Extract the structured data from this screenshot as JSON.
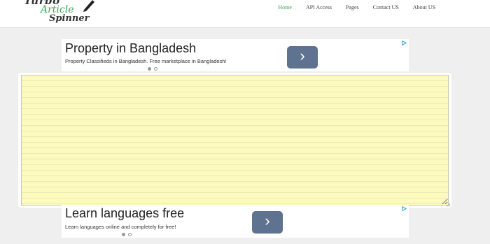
{
  "logo": {
    "line1": "Turbo",
    "line2": "Article",
    "line3": "Spinner"
  },
  "nav": {
    "items": [
      {
        "label": "Home",
        "active": true
      },
      {
        "label": "API Access"
      },
      {
        "label": "Pages"
      },
      {
        "label": "Contact US"
      },
      {
        "label": "About US"
      }
    ]
  },
  "ad_top": {
    "headline": "Property in Bangladesh",
    "description": "Property Classifieds in Bangladesh. Free marketplace in Bangladesh!",
    "arrow": "›"
  },
  "editor": {
    "value": "",
    "placeholder": ""
  },
  "ad_bottom": {
    "headline": "Learn languages free",
    "description": "Learn languages online and completely for free!",
    "arrow": "›"
  },
  "colors": {
    "accent": "#3aa55a",
    "ad_button": "#5f7290",
    "editor_bg": "#fdfac0"
  }
}
